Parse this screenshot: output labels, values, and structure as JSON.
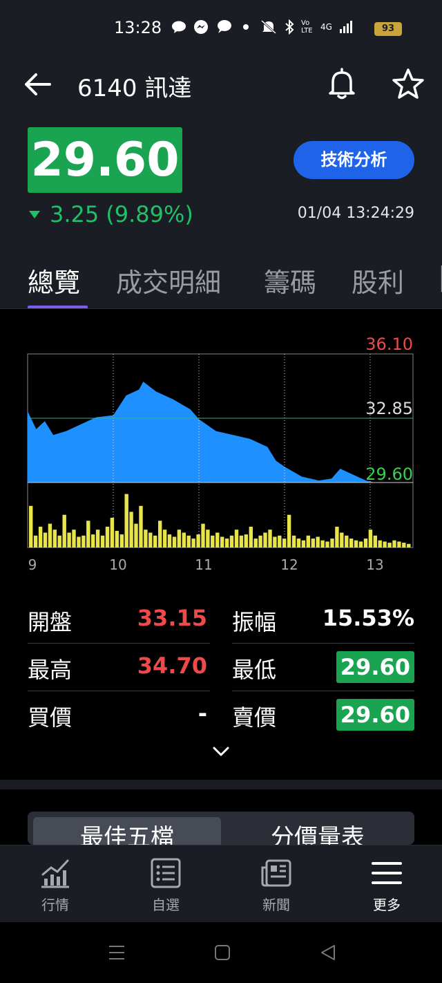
{
  "status_bar": {
    "time": "13:28",
    "battery": "93",
    "network_label": "4G",
    "volte_label": "Vo LTE"
  },
  "header": {
    "title": "6140 訊達",
    "price": "29.60",
    "change_value": "3.25",
    "change_percent": "(9.89%)",
    "timestamp": "01/04 13:24:29",
    "tech_button": "技術分析",
    "colors": {
      "up": "#ee4a4a",
      "down": "#1fc168",
      "accent": "#1f63e8"
    }
  },
  "tabs": [
    {
      "label": "總覽",
      "active": true
    },
    {
      "label": "成交明細",
      "active": false
    },
    {
      "label": "籌碼",
      "active": false
    },
    {
      "label": "股利",
      "active": false
    }
  ],
  "chart_data": {
    "type": "area",
    "price_levels": {
      "high": "36.10",
      "ref": "32.85",
      "last": "29.60"
    },
    "x_ticks": [
      "9",
      "10",
      "11",
      "12",
      "13"
    ],
    "price_series_approx": [
      [
        9.0,
        33.2
      ],
      [
        9.1,
        32.3
      ],
      [
        9.2,
        32.7
      ],
      [
        9.3,
        32.0
      ],
      [
        9.45,
        32.2
      ],
      [
        9.6,
        32.5
      ],
      [
        9.8,
        32.9
      ],
      [
        10.0,
        33.0
      ],
      [
        10.15,
        34.0
      ],
      [
        10.3,
        34.3
      ],
      [
        10.35,
        34.7
      ],
      [
        10.5,
        34.2
      ],
      [
        10.7,
        33.8
      ],
      [
        10.9,
        33.3
      ],
      [
        11.0,
        32.8
      ],
      [
        11.2,
        32.2
      ],
      [
        11.4,
        32.0
      ],
      [
        11.6,
        31.8
      ],
      [
        11.8,
        31.4
      ],
      [
        11.9,
        30.7
      ],
      [
        12.0,
        30.4
      ],
      [
        12.2,
        29.9
      ],
      [
        12.4,
        29.7
      ],
      [
        12.55,
        29.8
      ],
      [
        12.65,
        30.3
      ],
      [
        12.8,
        30.0
      ],
      [
        12.95,
        29.7
      ],
      [
        13.05,
        29.6
      ]
    ],
    "volume_relative": [
      0.7,
      0.2,
      0.35,
      0.25,
      0.4,
      0.3,
      0.2,
      0.55,
      0.25,
      0.3,
      0.18,
      0.2,
      0.45,
      0.22,
      0.3,
      0.2,
      0.35,
      0.5,
      0.28,
      0.22,
      0.9,
      0.6,
      0.4,
      0.7,
      0.3,
      0.25,
      0.2,
      0.45,
      0.3,
      0.22,
      0.18,
      0.3,
      0.25,
      0.2,
      0.15,
      0.22,
      0.4,
      0.3,
      0.2,
      0.25,
      0.18,
      0.15,
      0.2,
      0.3,
      0.2,
      0.22,
      0.35,
      0.15,
      0.2,
      0.25,
      0.3,
      0.18,
      0.2,
      0.15,
      0.55,
      0.2,
      0.15,
      0.12,
      0.2,
      0.15,
      0.18,
      0.12,
      0.1,
      0.15,
      0.35,
      0.25,
      0.2,
      0.15,
      0.12,
      0.1,
      0.15,
      0.3,
      0.2,
      0.12,
      0.1,
      0.08,
      0.12,
      0.1,
      0.08,
      0.06
    ]
  },
  "stats": [
    {
      "left_label": "開盤",
      "left_value": "33.15",
      "left_style": "red",
      "right_label": "振幅",
      "right_value": "15.53%",
      "right_style": "white"
    },
    {
      "left_label": "最高",
      "left_value": "34.70",
      "left_style": "red",
      "right_label": "最低",
      "right_value": "29.60",
      "right_style": "green-box"
    },
    {
      "left_label": "買價",
      "left_value": "-",
      "left_style": "white",
      "right_label": "賣價",
      "right_value": "29.60",
      "right_style": "green-box"
    }
  ],
  "segments": [
    {
      "label": "最佳五檔",
      "active": true
    },
    {
      "label": "分價量表",
      "active": false
    }
  ],
  "bottom_nav": [
    {
      "label": "行情",
      "icon": "market-chart-icon"
    },
    {
      "label": "自選",
      "icon": "watchlist-icon"
    },
    {
      "label": "新聞",
      "icon": "news-icon"
    },
    {
      "label": "更多",
      "icon": "menu-icon"
    }
  ]
}
